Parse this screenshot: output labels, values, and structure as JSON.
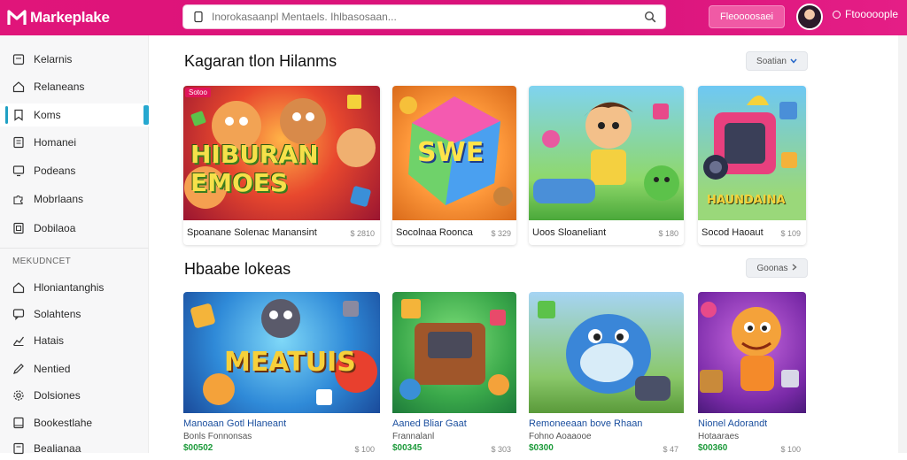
{
  "header": {
    "logo": "Markeplake",
    "search_placeholder": "Inorokasaanpl Mentaels. Ihlbasosaan...",
    "promo_button": "Fleoooosaei",
    "user_label": "Ftooooople"
  },
  "sidebar": {
    "items": [
      {
        "label": "Kelarnis",
        "icon": "calendar-icon"
      },
      {
        "label": "Relaneans",
        "icon": "home-icon"
      },
      {
        "label": "Koms",
        "icon": "bookmark-icon"
      },
      {
        "label": "Homanei",
        "icon": "document-icon"
      },
      {
        "label": "Podeans",
        "icon": "monitor-icon"
      },
      {
        "label": "Mobrlaans",
        "icon": "puzzle-icon"
      },
      {
        "label": "Dobilaoa",
        "icon": "file-icon"
      }
    ],
    "section_label": "MEKUDNCET",
    "items2": [
      {
        "label": "Hloniantanghis",
        "icon": "home-icon"
      },
      {
        "label": "Solahtens",
        "icon": "chat-icon"
      },
      {
        "label": "Hatais",
        "icon": "chart-icon"
      },
      {
        "label": "Nentied",
        "icon": "pencil-icon"
      },
      {
        "label": "Dolsiones",
        "icon": "settings-icon"
      },
      {
        "label": "Bookestlahe",
        "icon": "book-icon"
      },
      {
        "label": "Bealianaa",
        "icon": "document-icon"
      }
    ]
  },
  "section1": {
    "title": "Kagaran tlon Hilanms",
    "sort_label": "Soatian",
    "cards": [
      {
        "title": "Spoanane Solenac Manansint",
        "price": "$ 2810",
        "badge": "Sotoo",
        "art": "HIBURAN EMOES"
      },
      {
        "title": "Socolnaa Roonca",
        "price": "$ 329",
        "art": "SWE"
      },
      {
        "title": "Uoos Sloaneliant",
        "price": "$ 180"
      },
      {
        "title": "Socod Haoaut",
        "price": "$ 109",
        "art": "HAUNDAINA"
      }
    ]
  },
  "section2": {
    "title": "Hbaabe lokeas",
    "sort_label": "Goonas",
    "cards": [
      {
        "title": "Manoaan Gotl Hlaneant",
        "sub": "Bonls Fonnonsas",
        "price": "$ 100",
        "green": "$00502",
        "art": "MEATUIS"
      },
      {
        "title": "Aaned Bliar Gaat",
        "sub": "Frannalanl",
        "price": "$ 303",
        "green": "$00345"
      },
      {
        "title": "Remoneeaan bove Rhaan",
        "sub": "Fohno Aoaaooe",
        "price": "$ 47",
        "green": "$0300"
      },
      {
        "title": "Nionel Adorandt",
        "sub": "Hotaaraes",
        "price": "$ 100",
        "green": "$00360"
      }
    ]
  },
  "colors": {
    "brand": "#e0157a",
    "accent": "#26a8d0",
    "price_green": "#1c9a3a"
  }
}
